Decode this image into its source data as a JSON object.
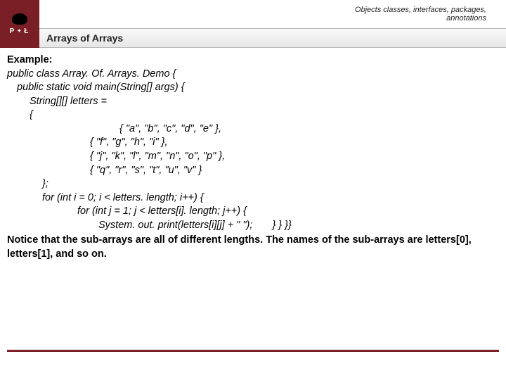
{
  "header": {
    "logo_left": "P",
    "logo_right": "Ł",
    "breadcrumb_line1": "Objects classes, interfaces, packages,",
    "breadcrumb_line2": "annotations",
    "title": "Arrays of Arrays"
  },
  "content": {
    "example_label": "Example:",
    "l1": "public class Array. Of. Arrays. Demo {",
    "l2": "public static void main(String[] args) {",
    "l3": "String[][] letters =",
    "l4": "{",
    "l5": "{ \"a\", \"b\", \"c\", \"d\", \"e\" },",
    "l6": "{ \"f\", \"g\", \"h\", \"i\" },",
    "l7": "{ \"j\", \"k\", \"l\", \"m\", \"n\", \"o\", \"p\" },",
    "l8": "{ \"q\", \"r\", \"s\", \"t\", \"u\", \"v\" }",
    "l9": "};",
    "l10": "for (int i = 0; i < letters. length; i++) {",
    "l11": "for (int j = 1; j < letters[i]. length; j++) {",
    "l12": "System. out. print(letters[i][j] + \" \");",
    "l12b": "} } }}",
    "notice": "Notice that the sub-arrays are all of different lengths. The names of the sub-arrays are letters[0], letters[1], and so on."
  }
}
